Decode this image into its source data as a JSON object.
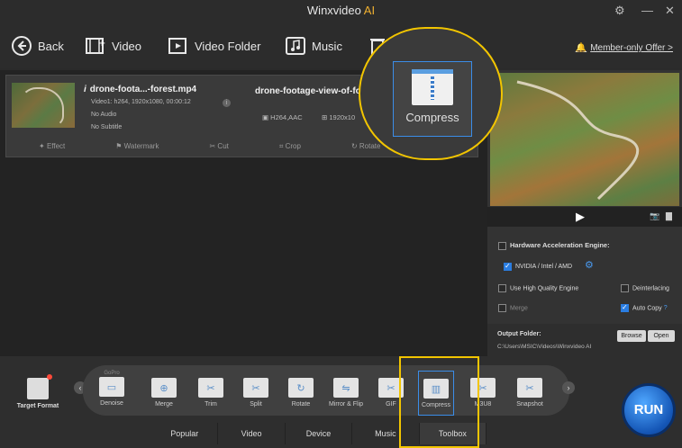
{
  "titlebar": {
    "app_name": "Winxvideo",
    "ai_badge": "AI",
    "gear_icon": "gear-icon",
    "minimize": "—",
    "close": "✕"
  },
  "toolbar": {
    "back": "Back",
    "video": "Video",
    "video_folder": "Video Folder",
    "music": "Music",
    "member_offer": "Member-only Offer >"
  },
  "file": {
    "name": "drone-foota...-forest.mp4",
    "video_info": "Video1: h264, 1920x1080, 00:00:12",
    "audio": "No Audio",
    "subtitle": "No Subtitle",
    "output_name": "drone-footage-view-of-fo",
    "output_codec": "H264,AAC",
    "output_res": "1920x10"
  },
  "edit_tools": [
    "Effect",
    "Watermark",
    "Cut",
    "Crop",
    "Rotate"
  ],
  "settings": {
    "hw_title": "Hardware Acceleration Engine:",
    "hw_vendor": "NVIDIA / Intel / AMD",
    "high_quality": "Use High Quality Engine",
    "deinterlacing": "Deinterlacing",
    "merge": "Merge",
    "auto_copy": "Auto Copy",
    "help": "?"
  },
  "output": {
    "label": "Output Folder:",
    "path": "C:\\Users\\MSIC\\Videos\\Winxvideo AI",
    "browse": "Browse",
    "open": "Open"
  },
  "target_format": "Target Format",
  "toolbox": [
    "Denoise",
    "Merge",
    "Trim",
    "Split",
    "Rotate",
    "Mirror & Flip",
    "GIF",
    "Compress",
    "M3U8",
    "Snapshot"
  ],
  "gopro": "GoPro",
  "tabs": [
    "Popular",
    "Video",
    "Device",
    "Music",
    "Toolbox"
  ],
  "run": "RUN",
  "zoom_label": "Compress"
}
